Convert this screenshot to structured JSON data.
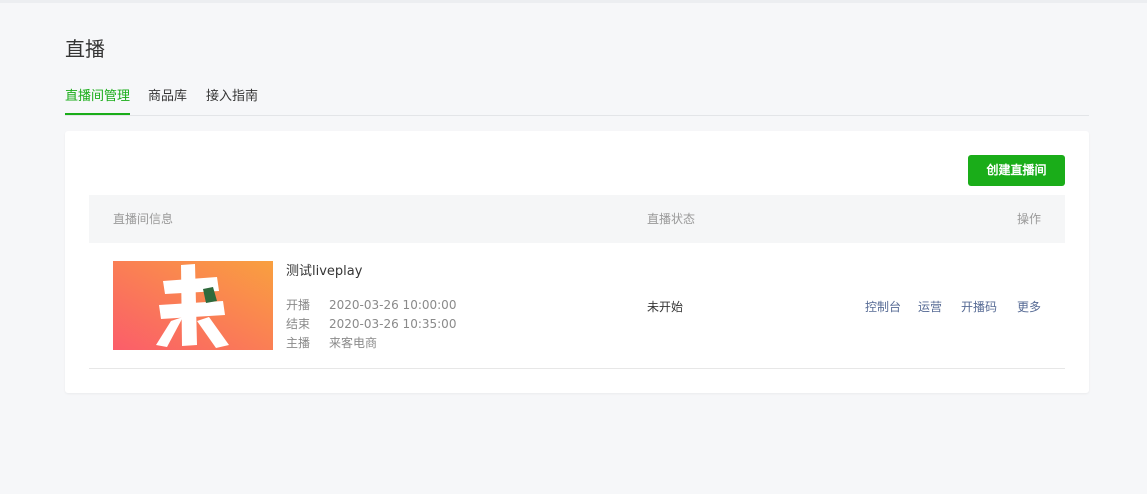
{
  "header": {
    "title": "直播"
  },
  "tabs": [
    {
      "label": "直播间管理",
      "active": true
    },
    {
      "label": "商品库",
      "active": false
    },
    {
      "label": "接入指南",
      "active": false
    }
  ],
  "toolbar": {
    "create_label": "创建直播间"
  },
  "table": {
    "columns": [
      "直播间信息",
      "直播状态",
      "操作"
    ],
    "rows": [
      {
        "cover_icon": "brand-logo-lai",
        "name": "测试liveplay",
        "start_label": "开播",
        "start_time": "2020-03-26 10:00:00",
        "end_label": "结束",
        "end_time": "2020-03-26 10:35:00",
        "anchor_label": "主播",
        "anchor": "来客电商",
        "status": "未开始",
        "actions": [
          "控制台",
          "运营",
          "开播码",
          "更多"
        ]
      }
    ]
  },
  "colors": {
    "accent": "#1aad19",
    "link": "#576b95",
    "background": "#f6f7f9"
  }
}
